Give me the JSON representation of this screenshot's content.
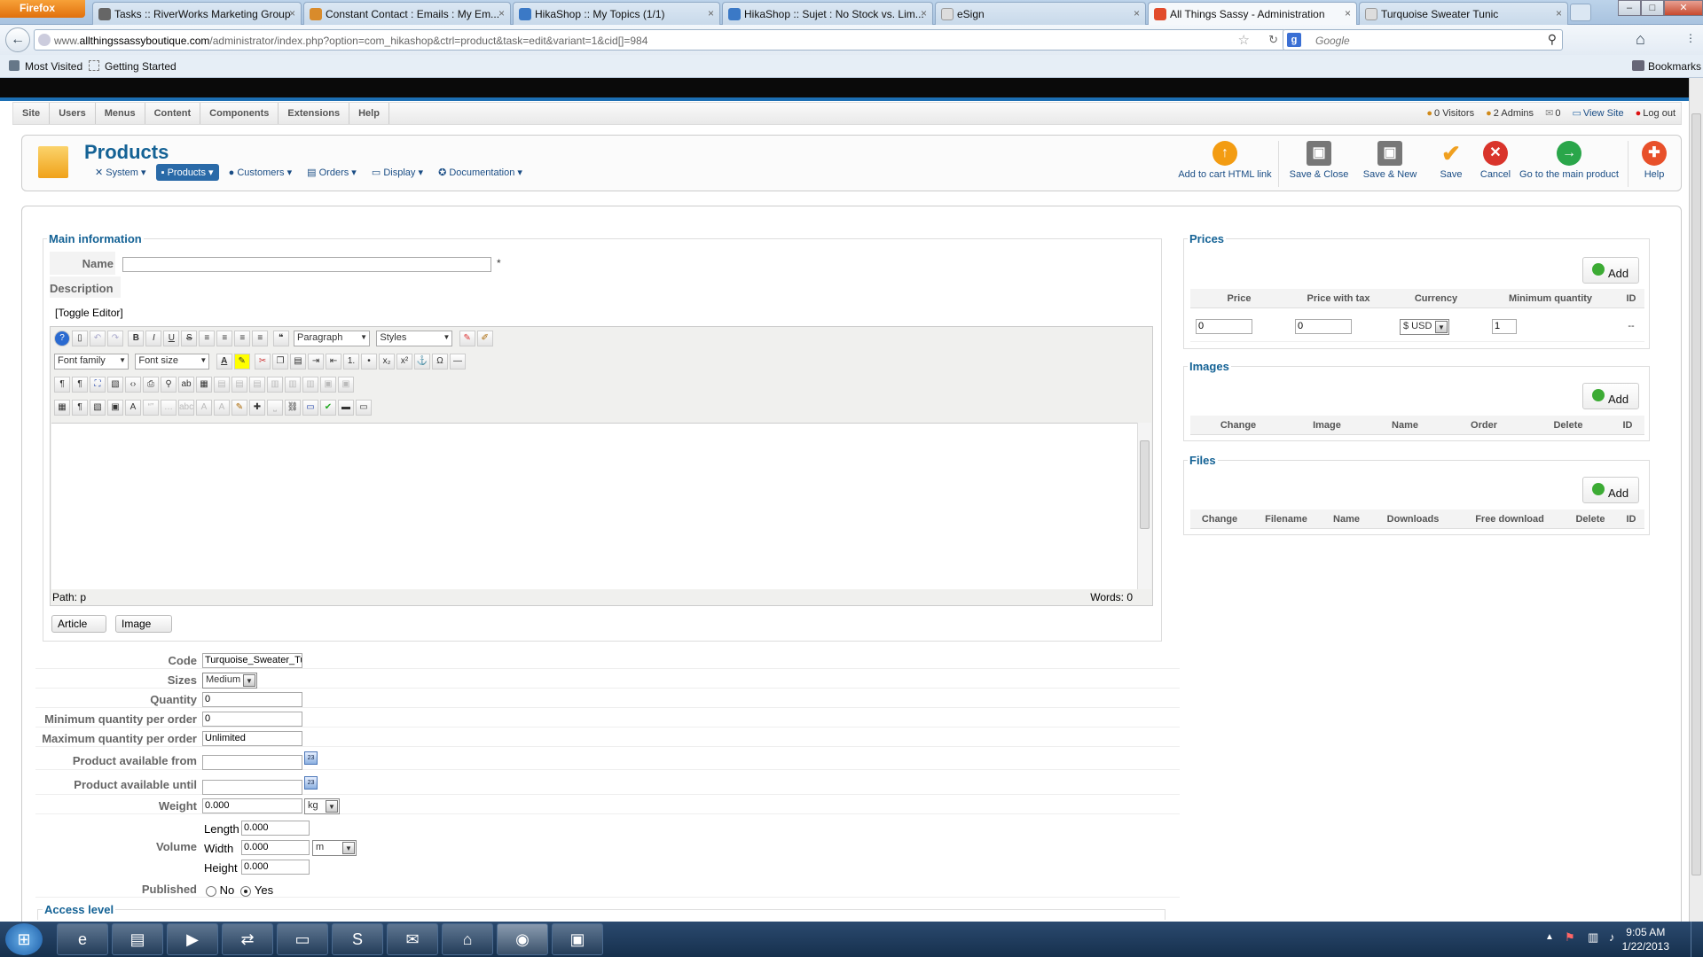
{
  "browser": {
    "app_button": "Firefox",
    "tabs": [
      {
        "label": "Tasks :: RiverWorks Marketing Group",
        "active": false
      },
      {
        "label": "Constant Contact : Emails : My Em...",
        "active": false
      },
      {
        "label": "HikaShop :: My Topics (1/1)",
        "active": false
      },
      {
        "label": "HikaShop :: Sujet : No Stock vs. Lim...",
        "active": false
      },
      {
        "label": "eSign",
        "active": false
      },
      {
        "label": "All Things Sassy - Administration",
        "active": true
      },
      {
        "label": "Turquoise Sweater Tunic",
        "active": false
      }
    ],
    "url_prefix": "www.",
    "url_domain": "allthingssassyboutique.com",
    "url_path": "/administrator/index.php?option=com_hikashop&ctrl=product&task=edit&variant=1&cid[]=984",
    "search_placeholder": "Google",
    "bookmarks": [
      "Most Visited",
      "Getting Started"
    ],
    "bookmarks_menu": "Bookmarks"
  },
  "joomla": {
    "menu": [
      "Site",
      "Users",
      "Menus",
      "Content",
      "Components",
      "Extensions",
      "Help"
    ],
    "status": {
      "visitors": "0 Visitors",
      "admins": "2 Admins",
      "messages": "0",
      "view_site": "View Site",
      "logout": "Log out"
    }
  },
  "page": {
    "title": "Products",
    "submenu": [
      "System",
      "Products",
      "Customers",
      "Orders",
      "Display",
      "Documentation"
    ],
    "toolbar": [
      {
        "label": "Add to cart HTML link",
        "icon": "arrow-up-icon",
        "color": "#f39c12"
      },
      {
        "label": "Save & Close",
        "icon": "save-close-icon",
        "color": "#777777"
      },
      {
        "label": "Save & New",
        "icon": "save-new-icon",
        "color": "#777777"
      },
      {
        "label": "Save",
        "icon": "check-icon",
        "color": "#f0a020"
      },
      {
        "label": "Cancel",
        "icon": "cancel-icon",
        "color": "#d9342b"
      },
      {
        "label": "Go to the main product",
        "icon": "arrow-right-icon",
        "color": "#2aa64a"
      },
      {
        "label": "Help",
        "icon": "help-icon",
        "color": "#e8502a"
      }
    ]
  },
  "main_info": {
    "legend": "Main information",
    "name_label": "Name",
    "name_value": "",
    "required_mark": "*",
    "description_label": "Description",
    "toggle_editor": "[Toggle Editor]",
    "editor": {
      "format_select": "Paragraph",
      "styles_select": "Styles",
      "font_family": "Font family",
      "font_size": "Font size",
      "path_label": "Path:",
      "path_value": "p",
      "words_label": "Words: 0"
    },
    "article_button": "Article",
    "image_button": "Image"
  },
  "fields": {
    "code_label": "Code",
    "code_value": "Turquoise_Sweater_Tunic",
    "sizes_label": "Sizes",
    "sizes_value": "Medium",
    "quantity_label": "Quantity",
    "quantity_value": "0",
    "min_qty_label": "Minimum quantity per order",
    "min_qty_value": "0",
    "max_qty_label": "Maximum quantity per order",
    "max_qty_value": "Unlimited",
    "avail_from_label": "Product available from",
    "avail_until_label": "Product available until",
    "calendar_day": "23",
    "weight_label": "Weight",
    "weight_value": "0.000",
    "weight_unit": "kg",
    "volume_label": "Volume",
    "length_label": "Length",
    "length_value": "0.000",
    "width_label": "Width",
    "width_value": "0.000",
    "height_label": "Height",
    "height_value": "0.000",
    "dim_unit": "m",
    "published_label": "Published",
    "published_no": "No",
    "published_yes": "Yes",
    "access_level": "Access level"
  },
  "prices": {
    "legend": "Prices",
    "add": "Add",
    "columns": [
      "Price",
      "Price with tax",
      "Currency",
      "Minimum quantity",
      "ID"
    ],
    "row": {
      "price": "0",
      "price_tax": "0",
      "currency": "$ USD",
      "min_qty": "1",
      "id": "--"
    }
  },
  "images": {
    "legend": "Images",
    "add": "Add",
    "columns": [
      "Change",
      "Image",
      "Name",
      "Order",
      "Delete",
      "ID"
    ]
  },
  "files": {
    "legend": "Files",
    "add": "Add",
    "columns": [
      "Change",
      "Filename",
      "Name",
      "Downloads",
      "Free download",
      "Delete",
      "ID"
    ]
  },
  "taskbar": {
    "time": "9:05 AM",
    "date": "1/22/2013"
  }
}
